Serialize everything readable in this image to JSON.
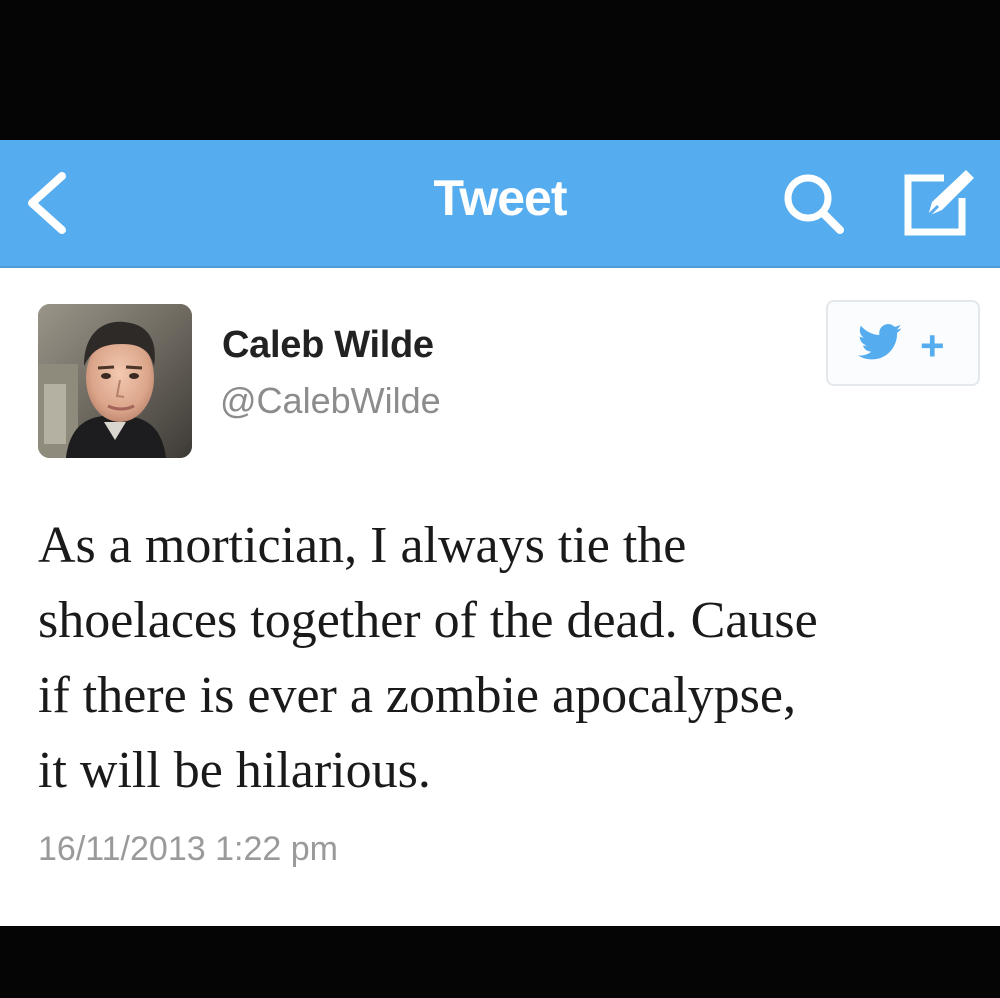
{
  "nav": {
    "title": "Tweet",
    "back_icon": "chevron-left-icon",
    "search_icon": "search-icon",
    "compose_icon": "compose-icon",
    "bar_color": "#55acee"
  },
  "tweet": {
    "author": {
      "display_name": "Caleb Wilde",
      "handle": "@CalebWilde",
      "avatar": "profile-photo"
    },
    "follow_button": {
      "icon": "twitter-bird-icon",
      "symbol": "+"
    },
    "text_lines": [
      "As a mortician, I always tie the",
      "shoelaces together of the dead. Cause",
      "if there is ever a zombie apocalypse,",
      "it will be hilarious."
    ],
    "timestamp": "16/11/2013 1:22 pm"
  }
}
